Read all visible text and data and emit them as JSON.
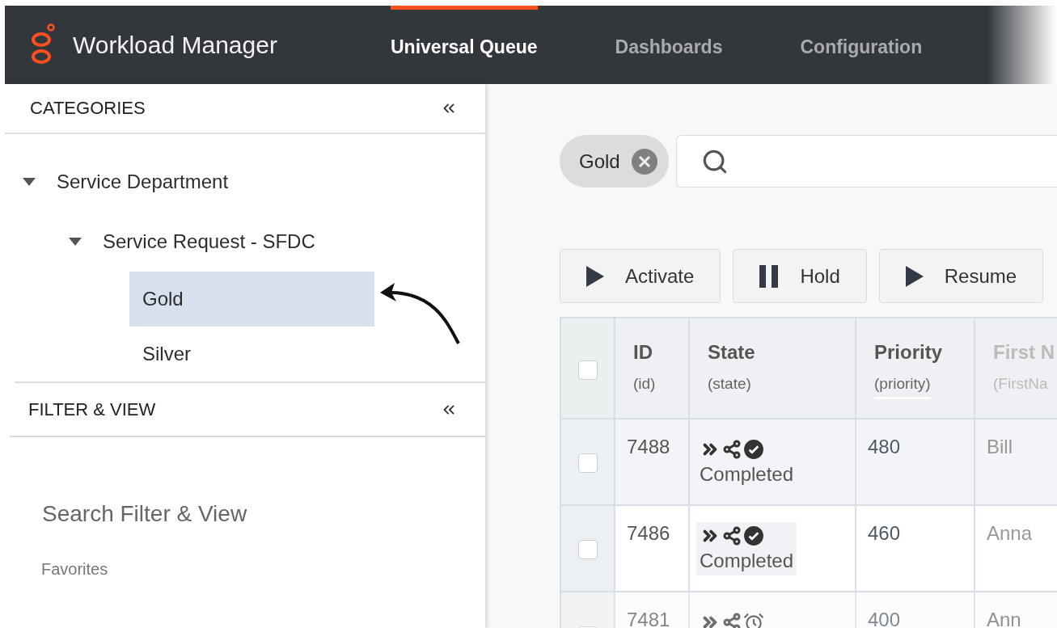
{
  "app": {
    "title": "Workload Manager"
  },
  "nav_tabs": [
    {
      "label": "Universal Queue",
      "selected": true
    },
    {
      "label": "Dashboards",
      "selected": false
    },
    {
      "label": "Configuration",
      "selected": false
    }
  ],
  "categories": {
    "title": "CATEGORIES",
    "tree": [
      {
        "label": "Service Department",
        "expanded": true,
        "selected": false,
        "children": [
          {
            "label": "Service Request - SFDC",
            "expanded": true,
            "selected": false,
            "children": [
              {
                "label": "Gold",
                "selected": true
              },
              {
                "label": "Silver",
                "selected": false
              }
            ]
          }
        ]
      }
    ]
  },
  "filter_view": {
    "title": "FILTER & VIEW",
    "search_placeholder": "Search Filter & View",
    "favorites": "Favorites"
  },
  "filter_chips": [
    {
      "label": "Gold"
    }
  ],
  "actions": [
    {
      "label": "Activate",
      "kind": "play"
    },
    {
      "label": "Hold",
      "kind": "pause"
    },
    {
      "label": "Resume",
      "kind": "play"
    }
  ],
  "table": {
    "select_all": {
      "checked": false
    },
    "columns": [
      {
        "label": "ID",
        "field": "(id)",
        "sorted": false
      },
      {
        "label": "State",
        "field": "(state)",
        "sorted": false
      },
      {
        "label": "Priority",
        "field": "(priority)",
        "sorted": true
      },
      {
        "label": "First N",
        "field": "(FirstNa",
        "sorted": false
      }
    ],
    "rows": [
      {
        "checked": false,
        "hovered": true,
        "faded": false,
        "id": "7488",
        "state_icons": [
          {
            "kind": "forward"
          },
          {
            "kind": "share"
          },
          {
            "kind": "done"
          }
        ],
        "state": "Completed",
        "priority": "480",
        "first_name": "Bill"
      },
      {
        "checked": false,
        "hovered": false,
        "faded": false,
        "id": "7486",
        "state_icons": [
          {
            "kind": "forward"
          },
          {
            "kind": "share"
          },
          {
            "kind": "done"
          }
        ],
        "state": "Completed",
        "priority": "460",
        "first_name": "Anna"
      },
      {
        "checked": false,
        "hovered": false,
        "faded": true,
        "id": "7481",
        "state_icons": [
          {
            "kind": "forward"
          },
          {
            "kind": "share"
          },
          {
            "kind": "alarm"
          }
        ],
        "priority": "400",
        "first_name": "Ann"
      }
    ]
  }
}
